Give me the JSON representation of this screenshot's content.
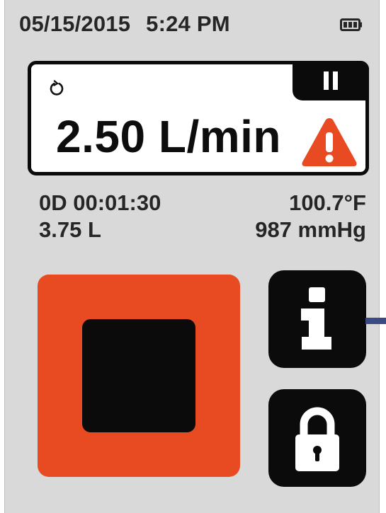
{
  "status_bar": {
    "date": "05/15/2015",
    "time": "5:24 PM",
    "battery_icon": "battery-full-icon"
  },
  "flow_panel": {
    "timer_icon": "timer-icon",
    "pause_icon": "pause-icon",
    "flow_rate": "2.50 L/min",
    "warning_icon": "warning-icon",
    "warning_color": "#e84a22"
  },
  "readings": {
    "elapsed": "0D 00:01:30",
    "volume": "3.75 L",
    "temperature": "100.7°F",
    "pressure": "987 mmHg"
  },
  "controls": {
    "stop_icon": "stop-icon",
    "stop_color": "#e84a22",
    "info_icon": "info-icon",
    "lock_icon": "lock-icon"
  }
}
